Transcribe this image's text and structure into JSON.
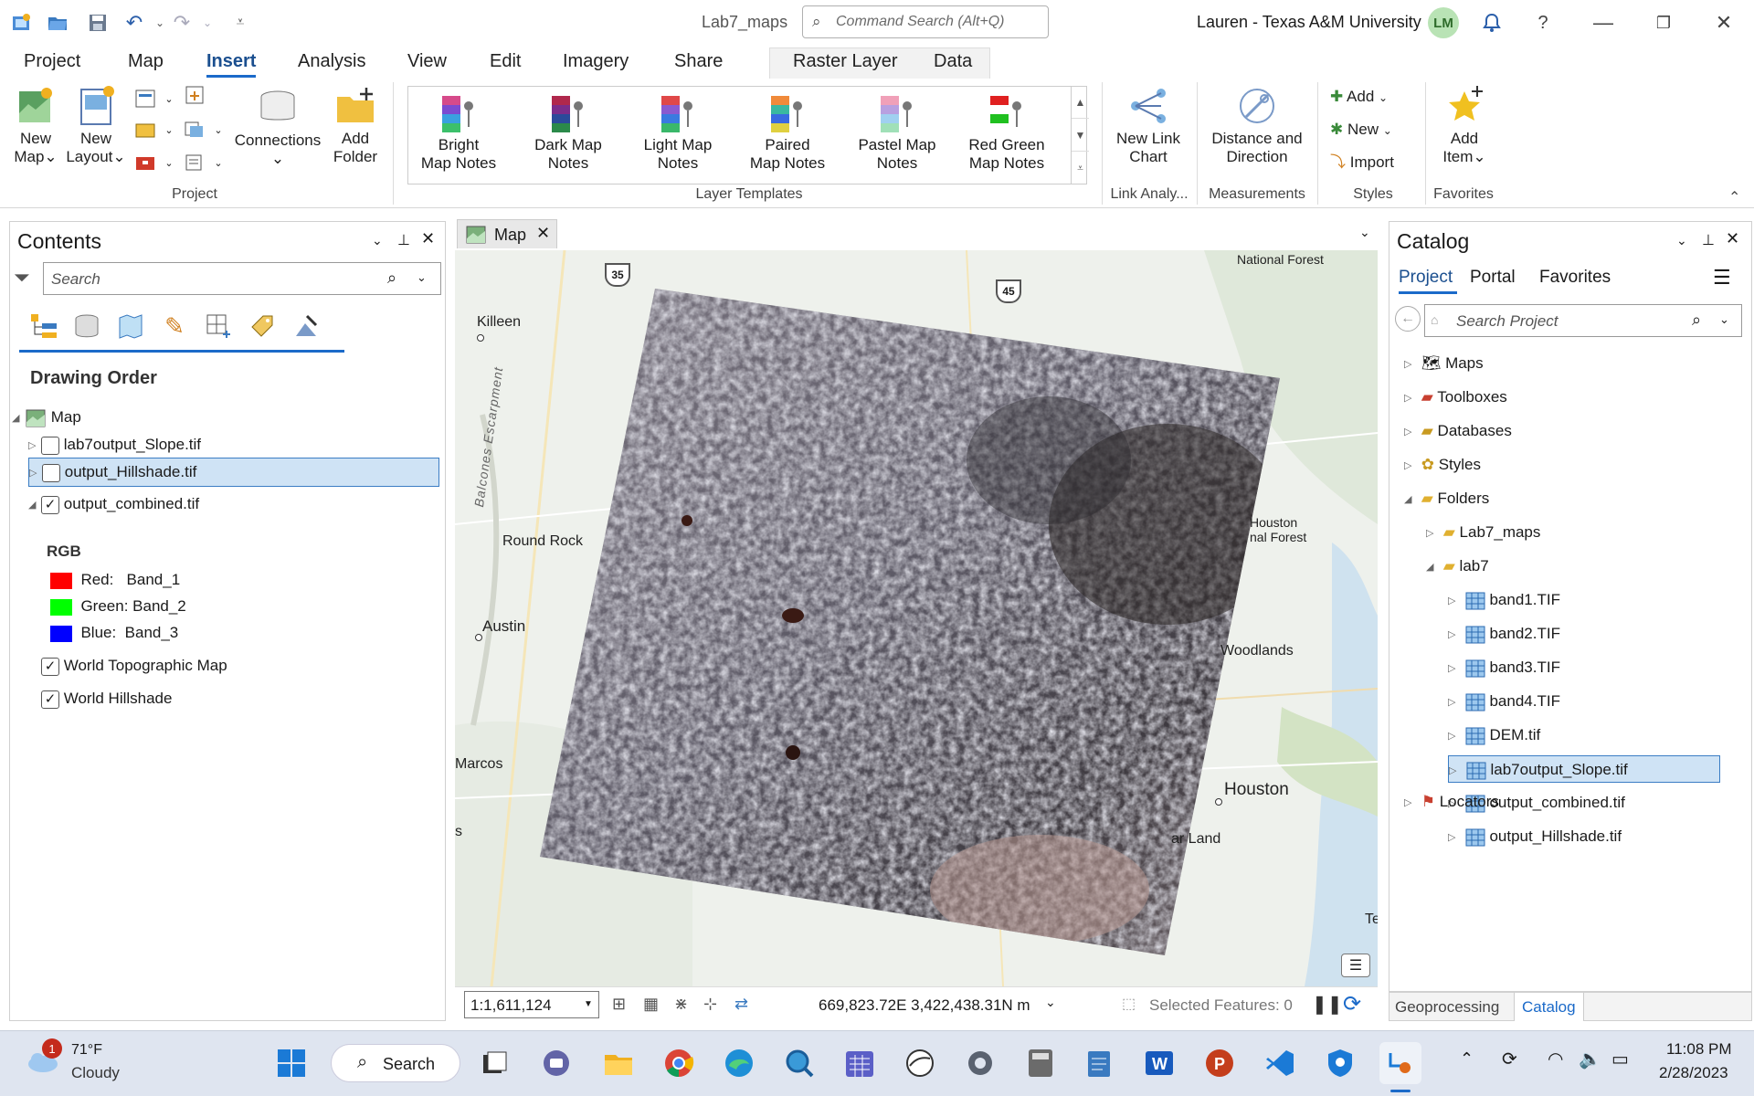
{
  "titlebar": {
    "project_name": "Lab7_maps",
    "command_search_placeholder": "Command Search (Alt+Q)",
    "user": "Lauren - Texas A&M University",
    "avatar_initials": "LM",
    "help": "?"
  },
  "tabs": [
    "Project",
    "Map",
    "Insert",
    "Analysis",
    "View",
    "Edit",
    "Imagery",
    "Share"
  ],
  "context_tabs": [
    "Raster Layer",
    "Data"
  ],
  "active_tab": "Insert",
  "ribbon": {
    "project_group": {
      "label": "Project",
      "new_map_1": "New",
      "new_map_2": "Map",
      "new_layout_1": "New",
      "new_layout_2": "Layout",
      "connections": "Connections",
      "add_folder_1": "Add",
      "add_folder_2": "Folder"
    },
    "layer_templates": {
      "label": "Layer Templates",
      "items": [
        {
          "l1": "Bright",
          "l2": "Map Notes",
          "colors": [
            "#d64a8a",
            "#7b4bd1",
            "#3aa0e0",
            "#3cc06b"
          ]
        },
        {
          "l1": "Dark Map",
          "l2": "Notes",
          "colors": [
            "#b0284c",
            "#7a2d8a",
            "#2b4a9a",
            "#2b8a4a"
          ]
        },
        {
          "l1": "Light Map",
          "l2": "Notes",
          "colors": [
            "#e04848",
            "#8a5ad0",
            "#3a7ae0",
            "#3ab86a"
          ]
        },
        {
          "l1": "Paired",
          "l2": "Map Notes",
          "colors": [
            "#f08a3a",
            "#3ab8a0",
            "#3a6ae0",
            "#e0d040"
          ]
        },
        {
          "l1": "Pastel Map",
          "l2": "Notes",
          "colors": [
            "#f0a0b8",
            "#b8a0e0",
            "#a0d0f0",
            "#a0e0b8"
          ]
        },
        {
          "l1": "Red Green",
          "l2": "Map Notes",
          "colors": [
            "#e02020",
            "#ffffff",
            "#20c020",
            "#ffffff"
          ]
        }
      ]
    },
    "link_group": {
      "label": "Link Analy...",
      "btn_1": "New Link",
      "btn_2": "Chart"
    },
    "measure_group": {
      "label": "Measurements",
      "btn_1": "Distance and",
      "btn_2": "Direction"
    },
    "styles_group": {
      "label": "Styles",
      "add": "Add",
      "new": "New",
      "import": "Import"
    },
    "favorites_group": {
      "label": "Favorites",
      "btn_1": "Add",
      "btn_2": "Item"
    }
  },
  "contents": {
    "title": "Contents",
    "search_placeholder": "Search",
    "drawing_order": "Drawing Order",
    "map": "Map",
    "layers": [
      {
        "name": "lab7output_Slope.tif",
        "checked": false
      },
      {
        "name": "output_Hillshade.tif",
        "checked": false,
        "selected": true
      },
      {
        "name": "output_combined.tif",
        "checked": true
      }
    ],
    "rgb_label": "RGB",
    "bands": [
      {
        "label": "Red:   Band_1",
        "color": "#ff0000"
      },
      {
        "label": "Green: Band_2",
        "color": "#00ff00"
      },
      {
        "label": "Blue:  Band_3",
        "color": "#0000ff"
      }
    ],
    "basemaps": [
      {
        "name": "World Topographic Map",
        "checked": true
      },
      {
        "name": "World Hillshade",
        "checked": true
      }
    ]
  },
  "map": {
    "tab": "Map",
    "labels": {
      "killeen": "Killeen",
      "round_rock": "Round Rock",
      "austin": "Austin",
      "marcos": "Marcos",
      "s": "s",
      "houston": "Houston",
      "woodlands": "Woodlands",
      "ar_land": "ar Land",
      "national_forest": "National Forest",
      "houston_nf_1": "Houston",
      "houston_nf_2": "nal Forest",
      "balcones": "Balcones Escarpment",
      "te": "Te"
    },
    "shields": {
      "i35": "35",
      "i45": "45"
    },
    "scale": "1:1,611,124",
    "coords": "669,823.72E 3,422,438.31N m",
    "selected_features": "Selected Features: 0"
  },
  "catalog": {
    "title": "Catalog",
    "tabs": [
      "Project",
      "Portal",
      "Favorites"
    ],
    "search_placeholder": "Search Project",
    "items": [
      "Maps",
      "Toolboxes",
      "Databases",
      "Styles",
      "Folders"
    ],
    "folders": {
      "lab7_maps": "Lab7_maps",
      "lab7": "lab7"
    },
    "files": [
      "band1.TIF",
      "band2.TIF",
      "band3.TIF",
      "band4.TIF",
      "DEM.tif",
      "lab7output_Slope.tif",
      "output_combined.tif",
      "output_Hillshade.tif"
    ],
    "locators": "Locators",
    "bottom_tabs": [
      "Geoprocessing",
      "Catalog"
    ]
  },
  "taskbar": {
    "weather_temp": "71°F",
    "weather_desc": "Cloudy",
    "weather_badge": "1",
    "search": "Search",
    "time": "11:08 PM",
    "date": "2/28/2023"
  }
}
